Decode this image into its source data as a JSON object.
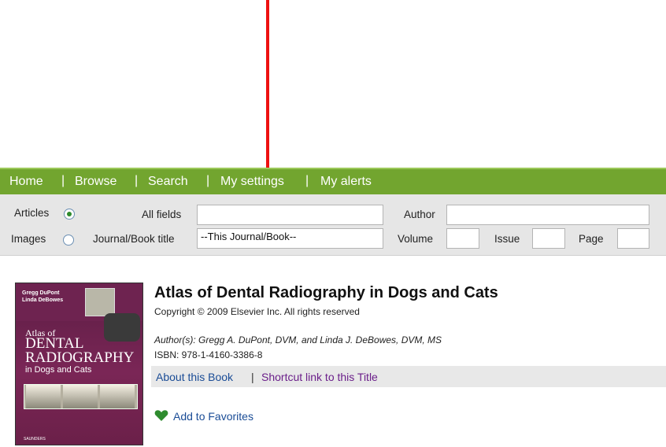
{
  "nav": {
    "items": [
      "Home",
      "Browse",
      "Search",
      "My settings",
      "My alerts"
    ],
    "separator": "|"
  },
  "search": {
    "articles_label": "Articles",
    "images_label": "Images",
    "all_fields_label": "All fields",
    "journal_label": "Journal/Book title",
    "journal_value": "--This Journal/Book--",
    "author_label": "Author",
    "volume_label": "Volume",
    "issue_label": "Issue",
    "page_label": "Page",
    "selected_scope": "Articles"
  },
  "cover": {
    "authors": [
      "Gregg DuPont",
      "Linda DeBowes"
    ],
    "title_line1": "Atlas of",
    "title_line2": "DENTAL",
    "title_line3": "RADIOGRAPHY",
    "title_line4": "in Dogs and Cats",
    "publisher": "SAUNDERS"
  },
  "book": {
    "title": "Atlas of Dental Radiography in Dogs and Cats",
    "copyright": "Copyright © 2009 Elsevier Inc. All rights reserved",
    "authors": "Author(s): Gregg A. DuPont, DVM, and Linda J. DeBowes, DVM, MS",
    "isbn": "ISBN: 978-1-4160-3386-8",
    "about_link": "About this Book",
    "link_sep": "|",
    "shortcut_link": "Shortcut link to this Title",
    "favorites": "Add to Favorites"
  },
  "colors": {
    "nav_bg": "#72a52f",
    "arrow": "#ee1111",
    "link_blue": "#1a4c96",
    "link_purple": "#6b1f8a"
  }
}
